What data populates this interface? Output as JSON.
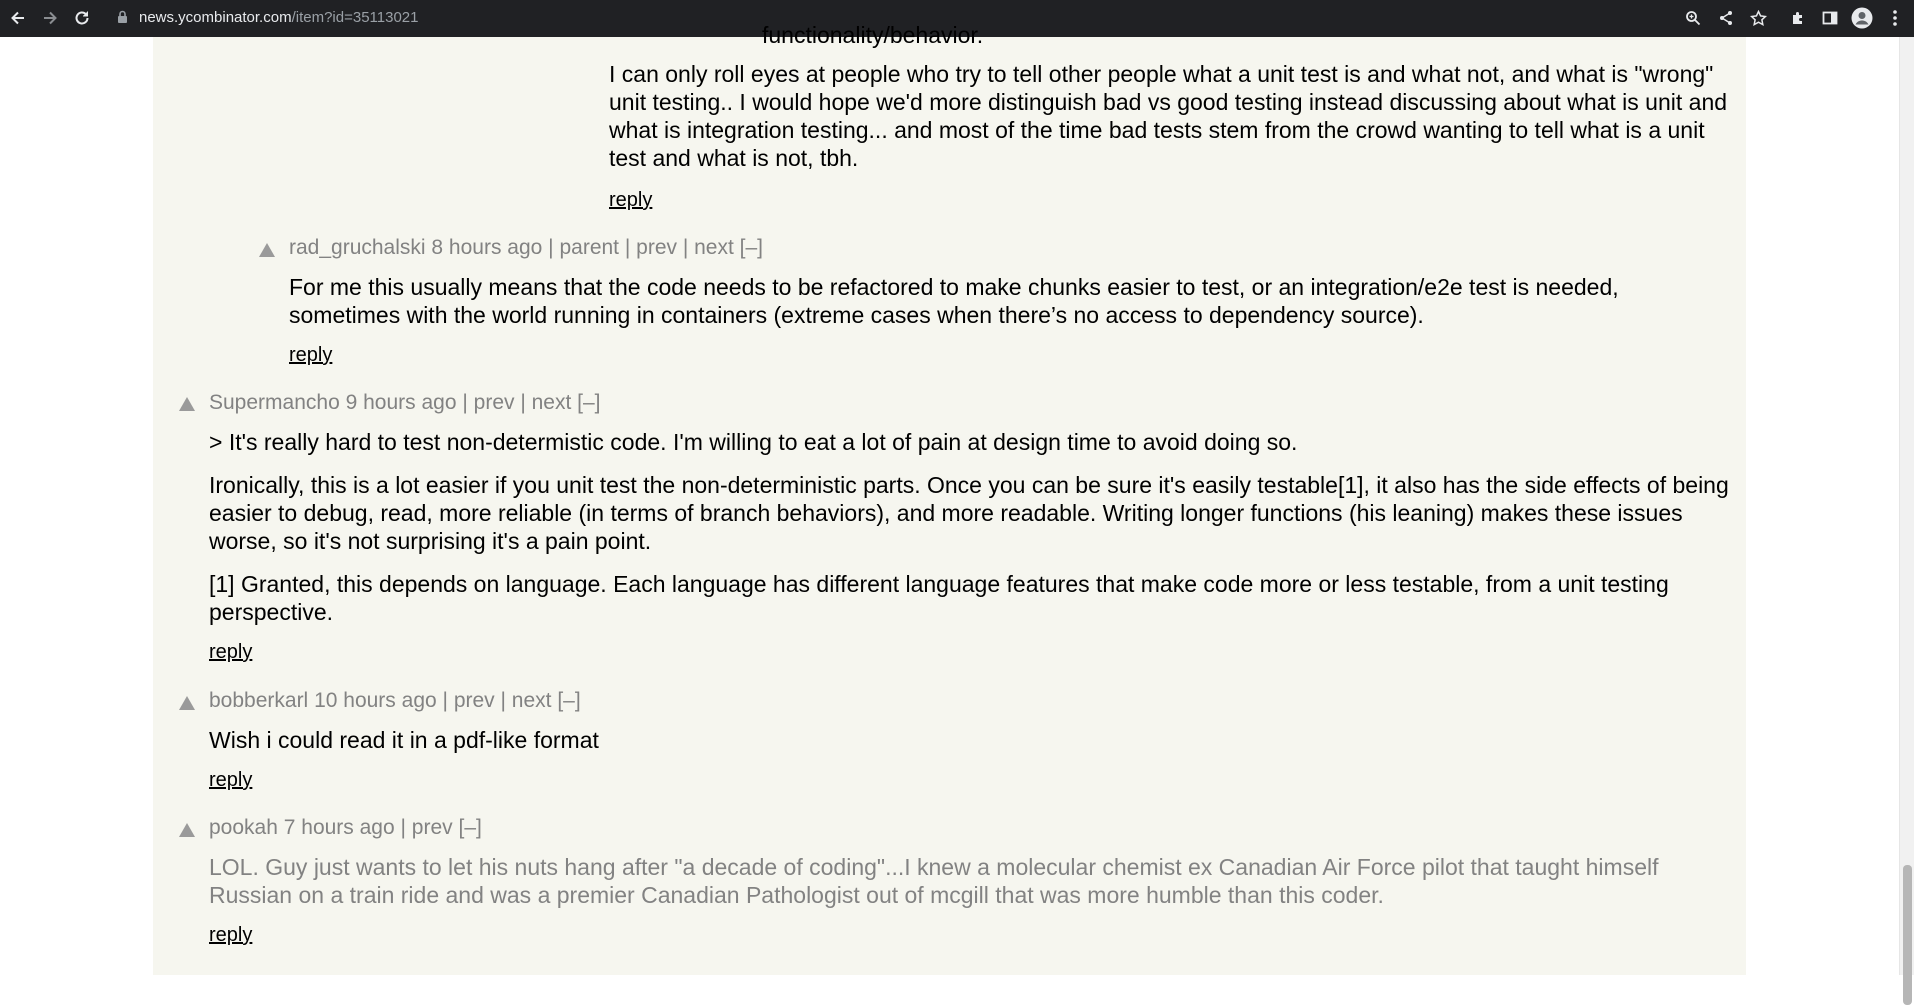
{
  "browser": {
    "url_host": "news.ycombinator.com",
    "url_path": "/item?id=35113021"
  },
  "comments": [
    {
      "clipped_top": "functionality/behavior.",
      "paragraphs": [
        "I can only roll eyes at people who try to tell other people what a unit test is and what not, and what is \"wrong\" unit testing.. I would hope we'd more distinguish bad vs good testing instead discussing about what is unit and what is integration testing... and most of the time bad tests stem from the crowd wanting to tell what is a unit test and what is not, tbh."
      ],
      "reply": "reply"
    },
    {
      "user": "rad_gruchalski",
      "age": "8 hours ago",
      "links": [
        "parent",
        "prev",
        "next",
        "[–]"
      ],
      "paragraphs": [
        "For me this usually means that the code needs to be refactored to make chunks easier to test, or an integration/e2e test is needed, sometimes with the world running in containers (extreme cases when there’s no access to dependency source)."
      ],
      "reply": "reply"
    },
    {
      "user": "Supermancho",
      "age": "9 hours ago",
      "links": [
        "prev",
        "next",
        "[–]"
      ],
      "paragraphs": [
        "> It's really hard to test non-determistic code. I'm willing to eat a lot of pain at design time to avoid doing so.",
        "Ironically, this is a lot easier if you unit test the non-deterministic parts. Once you can be sure it's easily testable[1], it also has the side effects of being easier to debug, read, more reliable (in terms of branch behaviors), and more readable. Writing longer functions (his leaning) makes these issues worse, so it's not surprising it's a pain point.",
        "[1] Granted, this depends on language. Each language has different language features that make code more or less testable, from a unit testing perspective."
      ],
      "reply": "reply"
    },
    {
      "user": "bobberkarl",
      "age": "10 hours ago",
      "links": [
        "prev",
        "next",
        "[–]"
      ],
      "paragraphs": [
        "Wish i could read it in a pdf-like format"
      ],
      "reply": "reply"
    },
    {
      "user": "pookah",
      "age": "7 hours ago",
      "links": [
        "prev",
        "[–]"
      ],
      "paragraphs": [
        "LOL. Guy just wants to let his nuts hang after \"a decade of coding\"...I knew a molecular chemist ex Canadian Air Force pilot that taught himself Russian on a train ride and was a premier Canadian Pathologist out of mcgill that was more humble than this coder."
      ],
      "reply": "reply"
    }
  ],
  "icons": {
    "nav": [
      "back-icon",
      "forward-icon",
      "reload-icon",
      "lock-icon"
    ],
    "right": [
      "zoom-icon",
      "share-icon",
      "bookmark-star-icon",
      "extensions-icon",
      "sidepanel-icon",
      "profile-icon",
      "menu-icon"
    ]
  }
}
